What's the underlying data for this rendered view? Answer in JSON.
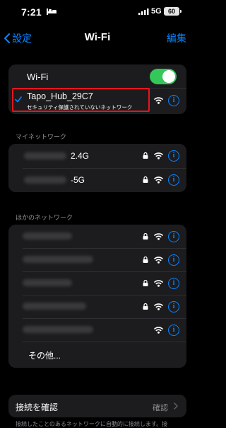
{
  "status_bar": {
    "time": "7:21",
    "network": "5G",
    "battery": "60"
  },
  "nav": {
    "back_label": "設定",
    "title": "Wi-Fi",
    "edit_label": "編集"
  },
  "wifi_toggle": {
    "label": "Wi-Fi",
    "on": true
  },
  "connected": {
    "name": "Tapo_Hub_29C7",
    "subtitle": "セキュリティ保護されていないネットワーク"
  },
  "my_networks": {
    "header": "マイネットワーク",
    "items": [
      {
        "name_suffix": "2.4G"
      },
      {
        "name_suffix": "-5G"
      }
    ]
  },
  "other_networks": {
    "header": "ほかのネットワーク",
    "other_label": "その他..."
  },
  "ask_to_join": {
    "label": "接続を確認",
    "value": "確認"
  },
  "footer_text": "接続したことのあるネットワークに自動的に接続します。接"
}
